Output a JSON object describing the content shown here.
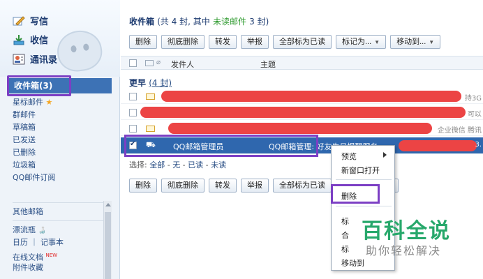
{
  "sidebar": {
    "top_nav": [
      {
        "label": "写信",
        "icon": "pen-icon"
      },
      {
        "label": "收信",
        "icon": "inbox-download-icon"
      },
      {
        "label": "通讯录",
        "icon": "contacts-icon"
      }
    ],
    "inbox_label": "收件箱(3)",
    "folders": [
      {
        "label": "星标邮件",
        "star": "★"
      },
      {
        "label": "群邮件"
      },
      {
        "label": "草稿箱"
      },
      {
        "label": "已发送"
      },
      {
        "label": "已删除"
      },
      {
        "label": "垃圾箱"
      },
      {
        "label": "QQ邮件订阅"
      }
    ],
    "other_mailboxes_label": "其他邮箱",
    "extras": [
      {
        "label": "漂流瓶",
        "suffix": "🍶"
      },
      {
        "label": "日历 ｜ 记事本"
      },
      {
        "label": "在线文档",
        "badge": "NEW"
      },
      {
        "label": "附件收藏"
      }
    ]
  },
  "main": {
    "title": {
      "name": "收件箱",
      "summary_prefix": "(共 4 封, 其中",
      "unread_text": "未读邮件",
      "summary_suffix": "3 封)"
    },
    "toolbar": {
      "delete": "删除",
      "delete_permanently": "彻底删除",
      "forward": "转发",
      "report": "举报",
      "mark_all_read": "全部标为已读",
      "mark_as": "标记为...",
      "move_to": "移动到..."
    },
    "columns": {
      "sender": "发件人",
      "subject": "主题"
    },
    "group": {
      "label": "更早",
      "count": "(4 封)"
    },
    "rows": [
      {
        "tail": "持3G"
      },
      {
        "tail": "可以"
      },
      {
        "tail": "企业微信 腾讯"
      },
      {
        "sender": "QQ邮箱管理员",
        "subject": "QQ邮箱管理: 好友生日提醒服务...",
        "tail": "3."
      }
    ],
    "select_line": {
      "prefix": "选择:",
      "all": "全部",
      "none": "无",
      "read": "已读",
      "unread": "未读"
    }
  },
  "context_menu": {
    "preview": "预览",
    "open_new_window": "新窗口打开",
    "delete": "删除",
    "fragments": [
      "标",
      "合",
      "标",
      "移动到"
    ]
  },
  "watermark": {
    "title": "百科全说",
    "subtitle": "助你轻松解决"
  },
  "colors": {
    "highlight": "#7c3fc4",
    "selected_row": "#2f67ae",
    "redaction": "#ec4444",
    "unread_green": "#2e9a2e",
    "watermark_green": "#27a86b"
  }
}
